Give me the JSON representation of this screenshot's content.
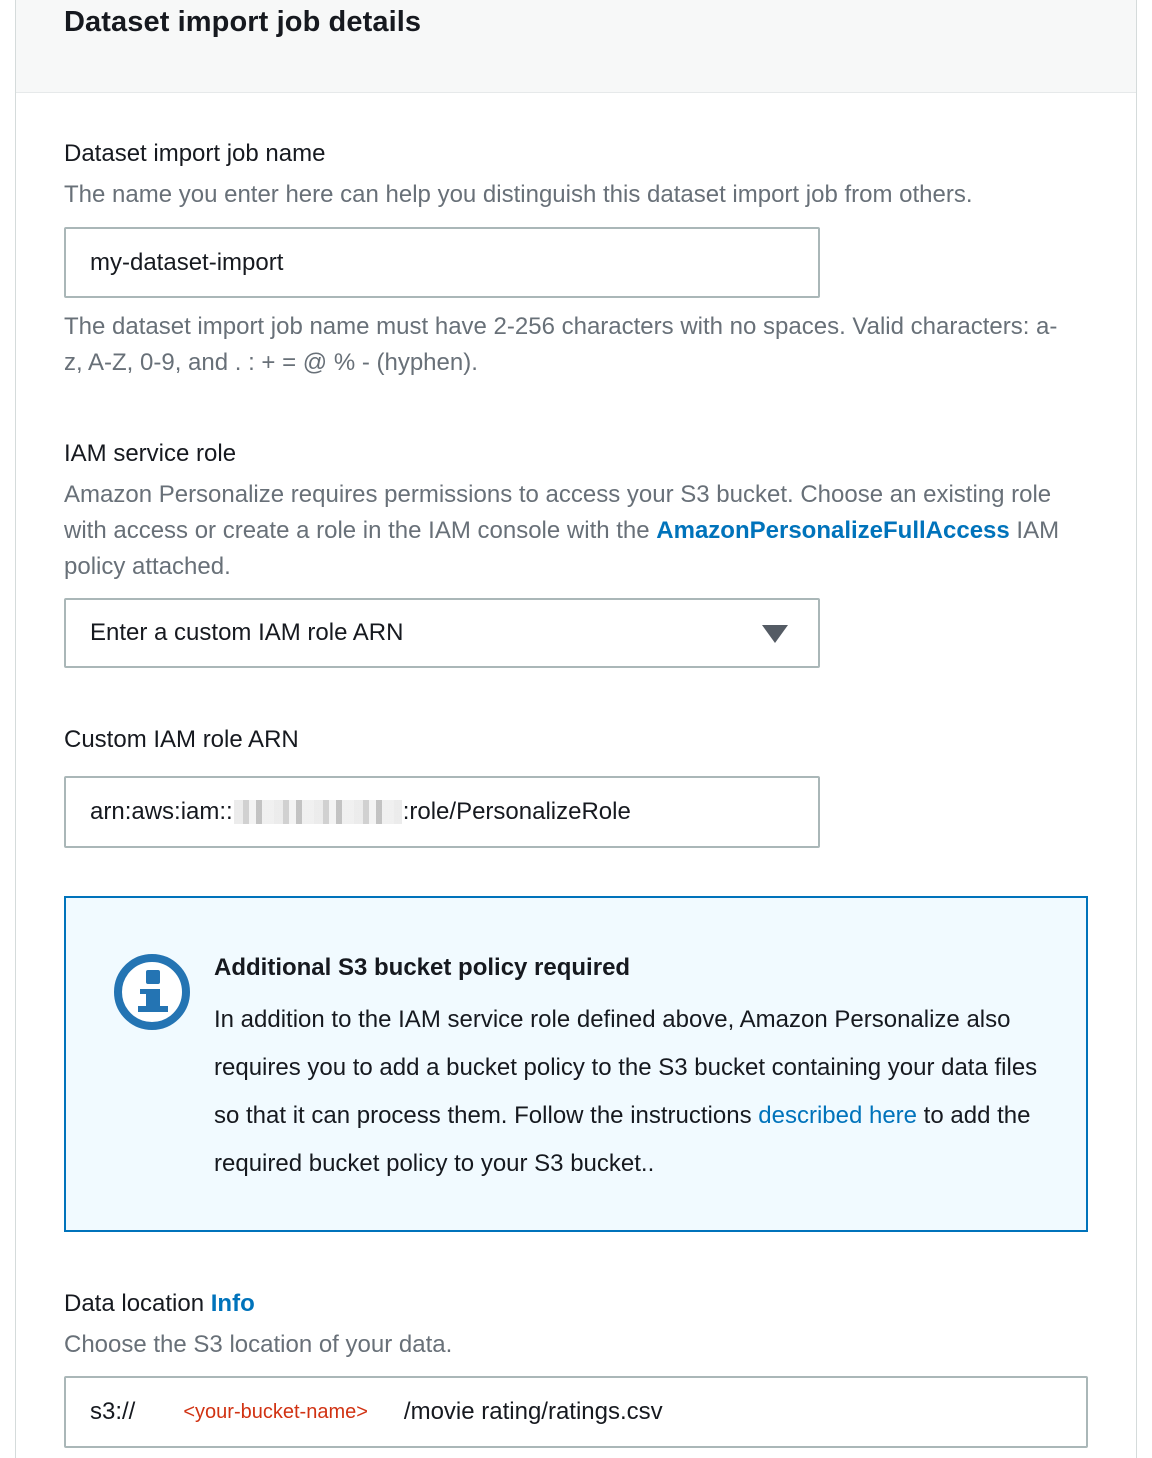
{
  "panel": {
    "title": "Dataset import job details"
  },
  "job_name": {
    "label": "Dataset import job name",
    "description": "The name you enter here can help you distinguish this dataset import job from others.",
    "value": "my-dataset-import",
    "constraint_line1": "The dataset import job name must have 2-256 characters with no spaces. Valid characters: a-",
    "constraint_line2": "z, A-Z, 0-9, and . : + = @ % - (hyphen)."
  },
  "iam_role": {
    "label": "IAM service role",
    "description_line1": "Amazon Personalize requires permissions to access your S3 bucket. Choose an existing role",
    "description_line2_before": "with access or create a role in the IAM console with the ",
    "policy_link": "AmazonPersonalizeFullAccess",
    "description_line2_after": " IAM",
    "description_line3": "policy attached.",
    "selected": "Enter a custom IAM role ARN",
    "icon": "caret-down-icon"
  },
  "custom_arn": {
    "label": "Custom IAM role ARN",
    "value_prefix": "arn:aws:iam::",
    "value_suffix": ":role/PersonalizeRole"
  },
  "alert": {
    "icon": "info-icon",
    "title": "Additional S3 bucket policy required",
    "body_before": "In addition to the IAM service role defined above, Amazon Personalize also requires you to add a bucket policy to the S3 bucket containing your data files so that it can process them. Follow the instructions ",
    "body_link": "described here",
    "body_after": " to add the required bucket policy to your S3 bucket..",
    "border_color": "#0073bb",
    "background_color": "#f1faff"
  },
  "data_location": {
    "label": "Data location",
    "info_link": "Info",
    "description": "Choose the S3 location of your data.",
    "prefix": "s3://",
    "bucket_placeholder": "<your-bucket-name>",
    "path": "/movie rating/ratings.csv"
  },
  "colors": {
    "link": "#0073bb",
    "muted_text": "#687078",
    "annotation_red": "#d13212"
  }
}
